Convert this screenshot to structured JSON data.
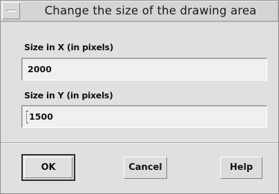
{
  "dialog": {
    "title": "Change the size of the drawing area",
    "menu_icon": "window-menu-icon"
  },
  "size_x": {
    "label": "Size in X (in pixels)",
    "value": "2000"
  },
  "size_y": {
    "label": "Size in Y (in pixels)",
    "value": "1500"
  },
  "buttons": {
    "ok": "OK",
    "cancel": "Cancel",
    "help": "Help"
  }
}
